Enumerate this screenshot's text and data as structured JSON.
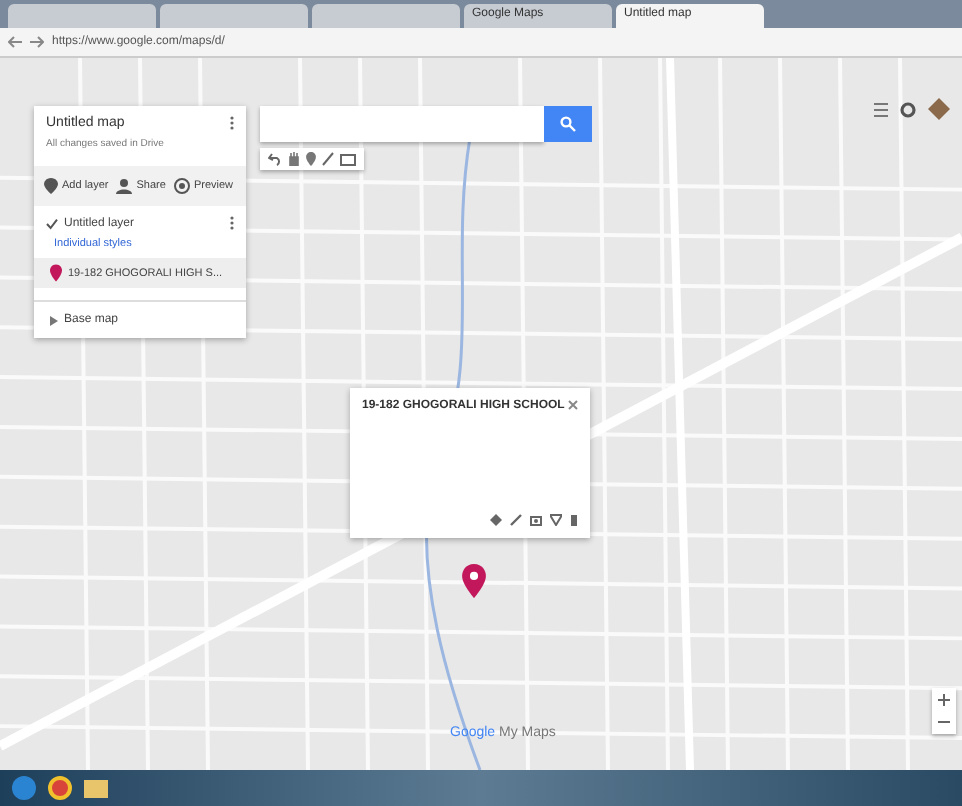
{
  "browser": {
    "tabs": [
      {
        "selected": false
      },
      {
        "selected": false
      },
      {
        "selected": false
      },
      {
        "title": "Google Maps",
        "selected": false
      },
      {
        "title": "Untitled map",
        "selected": true
      }
    ],
    "url": "https://www.google.com/maps/d/"
  },
  "panel": {
    "title": "Untitled map",
    "status": "All changes saved in Drive",
    "actions": [
      {
        "kind": "layer",
        "label": "Add layer"
      },
      {
        "kind": "share",
        "label": "Share"
      },
      {
        "kind": "preview",
        "label": "Preview"
      }
    ],
    "layer": {
      "name": "Untitled layer",
      "checked": true,
      "style": "Individual styles",
      "features": [
        {
          "name": "19-182 GHOGORALI HIGH S...",
          "selected": true
        }
      ]
    },
    "base_map": "Base map"
  },
  "popup": {
    "title": "19-182 GHOGORALI HIGH SCHOOL"
  },
  "logo": {
    "brand": "Google",
    "product": "My Maps"
  }
}
